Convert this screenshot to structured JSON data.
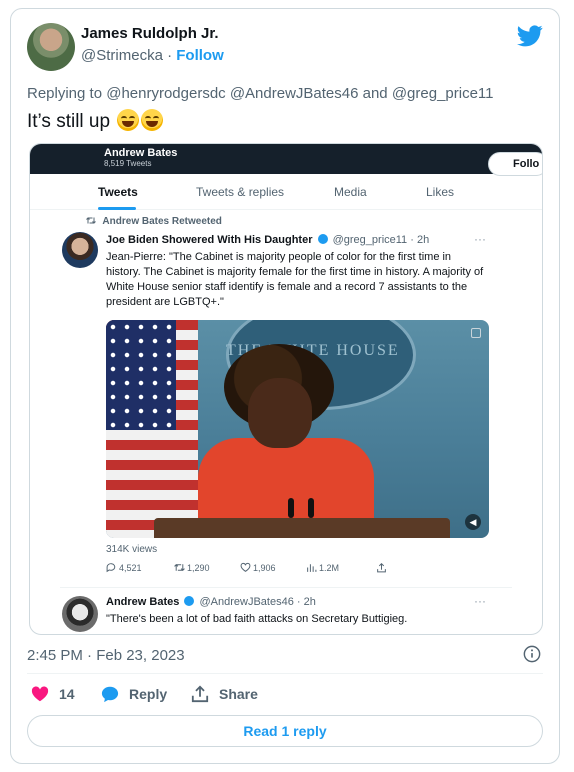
{
  "author": {
    "name": "James Ruldolph Jr.",
    "handle": "@Strimecka",
    "separator": "·",
    "follow_label": "Follow"
  },
  "replying_to": "Replying to @henryrodgersdc @AndrewJBates46 and @greg_price11",
  "tweet_text": "It’s still up",
  "screenshot": {
    "profile_name": "Andrew Bates",
    "profile_count": "8,519 Tweets",
    "follow_label": "Follo",
    "tabs": [
      "Tweets",
      "Tweets & replies",
      "Media",
      "Likes"
    ],
    "retweeted_by": "Andrew Bates Retweeted",
    "quoted": {
      "name": "Joe Biden Showered With His Daughter",
      "handle": "@greg_price11",
      "time": "· 2h",
      "body": "Jean-Pierre: \"The Cabinet is majority people of color for the first time in history. The Cabinet is majority female for the first time in history. A majority of White House senior staff identify is female and a record 7 assistants to the president are LGBTQ+.\"",
      "video_backdrop_text": "THE WHITE HOUSE",
      "views": "314K views",
      "replies": "4,521",
      "retweets": "1,290",
      "likes": "1,906",
      "view_count": "1.2M"
    },
    "reply": {
      "name": "Andrew Bates",
      "handle": "@AndrewJBates46",
      "time": "· 2h",
      "body": "\"There's been a lot of bad faith attacks on Secretary Buttigieg."
    }
  },
  "timestamp": "2:45 PM · Feb 23, 2023",
  "engagement": {
    "likes": "14",
    "reply_label": "Reply",
    "share_label": "Share"
  },
  "read_replies_label": "Read 1 reply",
  "colors": {
    "accent": "#1d9bf0",
    "like": "#f91880",
    "text": "#0f1419",
    "muted": "#536471"
  }
}
